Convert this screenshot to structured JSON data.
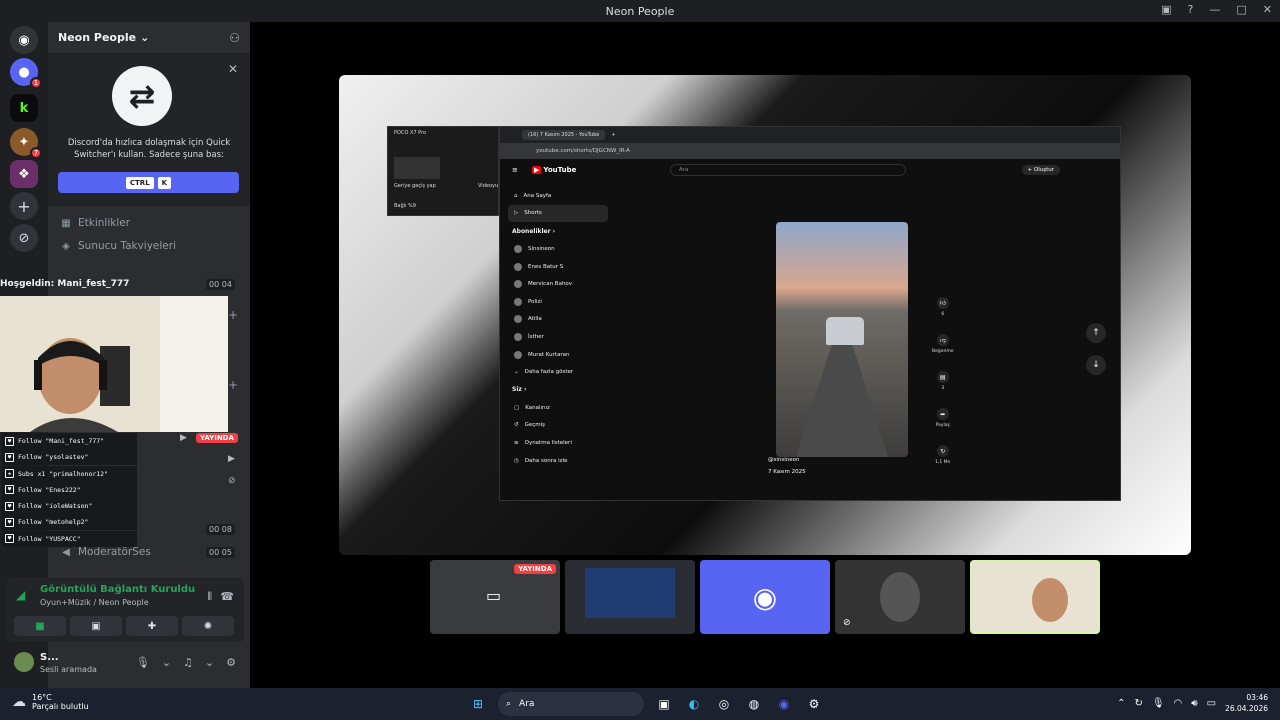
{
  "window": {
    "title": "Neon People"
  },
  "titlebar_controls": [
    "▣",
    "?",
    "—",
    "□",
    "✕"
  ],
  "guilds": [
    {
      "name": "discord-home",
      "glyph": "◉",
      "color": "#5865f2"
    },
    {
      "name": "server-neon",
      "glyph": "●",
      "color": "#5865f2",
      "badge": "1"
    },
    {
      "name": "server-k",
      "glyph": "k",
      "color": "#53fc18"
    },
    {
      "name": "server-game",
      "glyph": "✦",
      "color": "#8b5a2b",
      "badge": "7"
    },
    {
      "name": "server-art",
      "glyph": "❖",
      "color": "#6b2f6a"
    }
  ],
  "server": {
    "name": "Neon People"
  },
  "quick_switcher": {
    "text": "Discord'da hızlıca dolaşmak için Quick Switcher'ı kullan. Sadece şuna bas:",
    "key1": "CTRL",
    "key2": "K"
  },
  "nav": {
    "events": "Etkinlikler",
    "boosts": "Sunucu Takviyeleri"
  },
  "overlay": {
    "welcome": "Hoşgeldin: Mani_fest_777"
  },
  "counts": {
    "c1a": "00",
    "c1b": "04",
    "c2a": "00",
    "c2b": "08",
    "c3a": "00",
    "c3b": "05"
  },
  "live_label": "YAYINDA",
  "follows": [
    {
      "text": "Follow \"Mani_fest_777\""
    },
    {
      "text": "Follow \"ysolastev\""
    },
    {
      "text": "Subs x1 \"primalhonor12\""
    },
    {
      "text": "Follow \"Enes222\""
    },
    {
      "text": "Follow \"ioleWatson\""
    },
    {
      "text": "Follow \"metohelp2\""
    },
    {
      "text": "Follow \"YUSPACC\""
    }
  ],
  "channel_moderator": "ModeratörSes",
  "voice": {
    "status": "Görüntülü Bağlantı Kuruldu",
    "channel": "Oyun+Müzik / Neon People"
  },
  "user": {
    "name": "S...",
    "status": "Sesli aramada"
  },
  "stream": {
    "poco_title": "POCO X7 Pro",
    "poco_label1": "Geriye geçiş yap",
    "poco_label2": "Videoyu",
    "poco_footer": "Bağlı   %9",
    "tab_title": "(16) 7 Kasım 2025 - YouTube",
    "url": "youtube.com/shorts/DJGCNW_IR-A",
    "yt_logo": "YouTube",
    "yt_search": "Ara",
    "yt_create": "+ Oluştur",
    "sidebar_main": [
      "Ana Sayfa",
      "Shorts"
    ],
    "subs_header": "Abonelikler  ›",
    "subs": [
      "Sinsineon",
      "Enes Batur S",
      "Mervican Bahov",
      "Polizi",
      "Atilla",
      "İsther",
      "Murat Kurtaran",
      "Daha fazla göster"
    ],
    "you_header": "Siz  ›",
    "you_items": [
      "Kanalınız",
      "Geçmiş",
      "Oynatma listeleri",
      "Daha sonra izle"
    ],
    "short_channel": "@sinsineon",
    "short_title": "7 Kasım 2025",
    "likes": "6",
    "dislike_label": "Beğenme",
    "comments": "3",
    "share": "Paylaş",
    "remix": "1,1 Mn"
  },
  "taskbar": {
    "temp": "16°C",
    "weather": "Parçalı bulutlu",
    "search": "Ara",
    "time": "03:46",
    "date": "26.04.2026"
  }
}
